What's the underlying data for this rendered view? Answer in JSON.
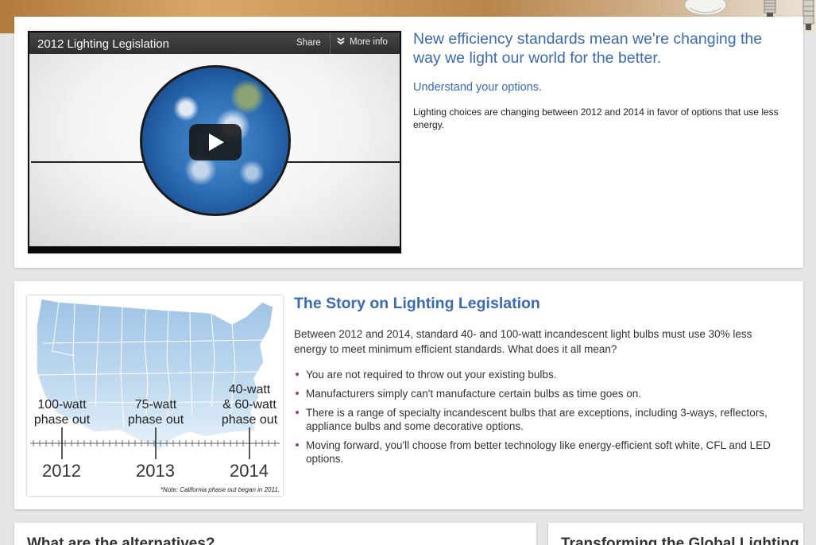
{
  "video": {
    "title": "2012 Lighting Legislation",
    "share_label": "Share",
    "more_info_label": "More info"
  },
  "intro": {
    "heading": "New efficiency standards mean we're changing the way we light our world for the better.",
    "subheading": "Understand your options.",
    "body": "Lighting choices are changing between 2012 and 2014 in favor of options that use less energy."
  },
  "map": {
    "phases": [
      {
        "label": "100-watt\nphase out",
        "year": "2012"
      },
      {
        "label": "75-watt\nphase out",
        "year": "2013"
      },
      {
        "label": "40-watt\n& 60-watt\nphase out",
        "year": "2014"
      }
    ],
    "note": "*Note: California phase out began in 2011."
  },
  "story": {
    "heading": "The Story on Lighting Legislation",
    "intro": "Between 2012 and 2014, standard 40- and 100-watt incandescent light bulbs must use 30% less energy to meet minimum efficient standards. What does it all mean?",
    "bullets": [
      "You are not required to throw out your existing bulbs.",
      "Manufacturers simply can't manufacture certain bulbs as time goes on.",
      "There is a range of specialty incandescent bulbs that are exceptions, including 3-ways, reflectors, appliance bulbs and some decorative options.",
      "Moving forward, you'll choose from better technology like energy-efficient soft white, CFL and LED options."
    ]
  },
  "alternatives": {
    "heading": "What are the alternatives?"
  },
  "transforming": {
    "heading": "Transforming the Global Lighting"
  },
  "colors": {
    "accent_blue": "#3b6bb0",
    "bullet_purple": "#9a3a8a",
    "page_bg": "#e6e6e6"
  }
}
